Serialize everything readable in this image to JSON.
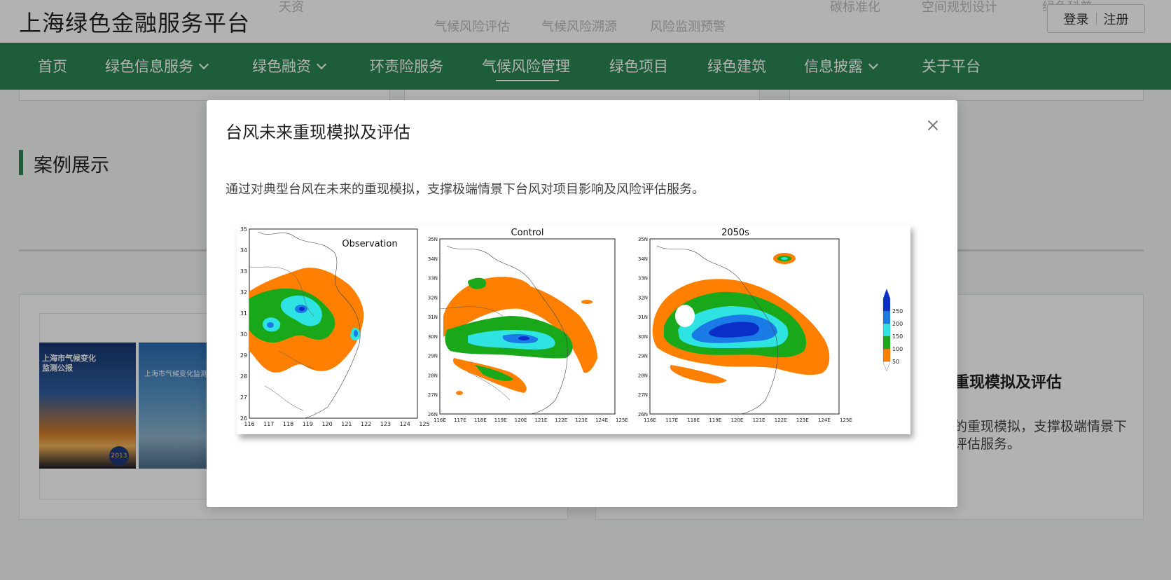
{
  "header": {
    "site_title": "上海绿色金融服务平台",
    "ghost_top": [
      "天资",
      "碳标准化",
      "空间规划设计",
      "绿色科普"
    ],
    "ghost_sub": [
      "气候风险评估",
      "气候风险溯源",
      "风险监测预警"
    ],
    "login_label": "登录",
    "register_label": "注册"
  },
  "nav": {
    "items": [
      {
        "label": "首页",
        "has_dropdown": false
      },
      {
        "label": "绿色信息服务",
        "has_dropdown": true
      },
      {
        "label": "绿色融资",
        "has_dropdown": true
      },
      {
        "label": "环责险服务",
        "has_dropdown": false
      },
      {
        "label": "气候风险管理",
        "has_dropdown": false,
        "active": true
      },
      {
        "label": "绿色项目",
        "has_dropdown": false
      },
      {
        "label": "绿色建筑",
        "has_dropdown": false
      },
      {
        "label": "信息披露",
        "has_dropdown": true
      },
      {
        "label": "关于平台",
        "has_dropdown": false
      }
    ],
    "color": "#2c8653"
  },
  "section": {
    "title": "案例展示"
  },
  "case_left": {
    "book1_title_line1": "上海市气候变化",
    "book1_title_line2": "监测公报",
    "book1_year": "2013",
    "book2_title": "上海市气候变化监测公"
  },
  "case_right": {
    "title": "重现模拟及评估",
    "desc_line1": "的重现模拟，支撑极端情景下",
    "desc_line2": "评估服务。"
  },
  "modal": {
    "title": "台风未来重现模拟及评估",
    "description": "通过对典型台风在未来的重现模拟，支撑极端情景下台风对项目影响及风险评估服务。",
    "close_icon": "close-icon",
    "figure": {
      "panels": [
        {
          "title": "Observation",
          "x_ticks": [
            "116",
            "117",
            "118",
            "119",
            "120",
            "121",
            "122",
            "123",
            "124",
            "125"
          ],
          "y_ticks": [
            "26",
            "27",
            "28",
            "29",
            "30",
            "31",
            "32",
            "33",
            "34",
            "35"
          ]
        },
        {
          "title": "Control",
          "x_ticks": [
            "116E",
            "117E",
            "118E",
            "119E",
            "120E",
            "121E",
            "122E",
            "123E",
            "124E",
            "125E"
          ],
          "y_ticks": [
            "26N",
            "27N",
            "28N",
            "29N",
            "30N",
            "31N",
            "32N",
            "33N",
            "34N",
            "35N"
          ]
        },
        {
          "title": "2050s",
          "x_ticks": [
            "116E",
            "117E",
            "118E",
            "119E",
            "120E",
            "121E",
            "122E",
            "123E",
            "124E",
            "125E"
          ],
          "y_ticks": [
            "26N",
            "27N",
            "28N",
            "29N",
            "30N",
            "31N",
            "32N",
            "33N",
            "34N",
            "35N"
          ]
        }
      ],
      "legend": {
        "levels": [
          "50",
          "100",
          "150",
          "200",
          "250"
        ],
        "colors": [
          "#ff8000",
          "#19a81a",
          "#2fe3e3",
          "#1a7be6",
          "#0a2fc8"
        ]
      }
    }
  }
}
